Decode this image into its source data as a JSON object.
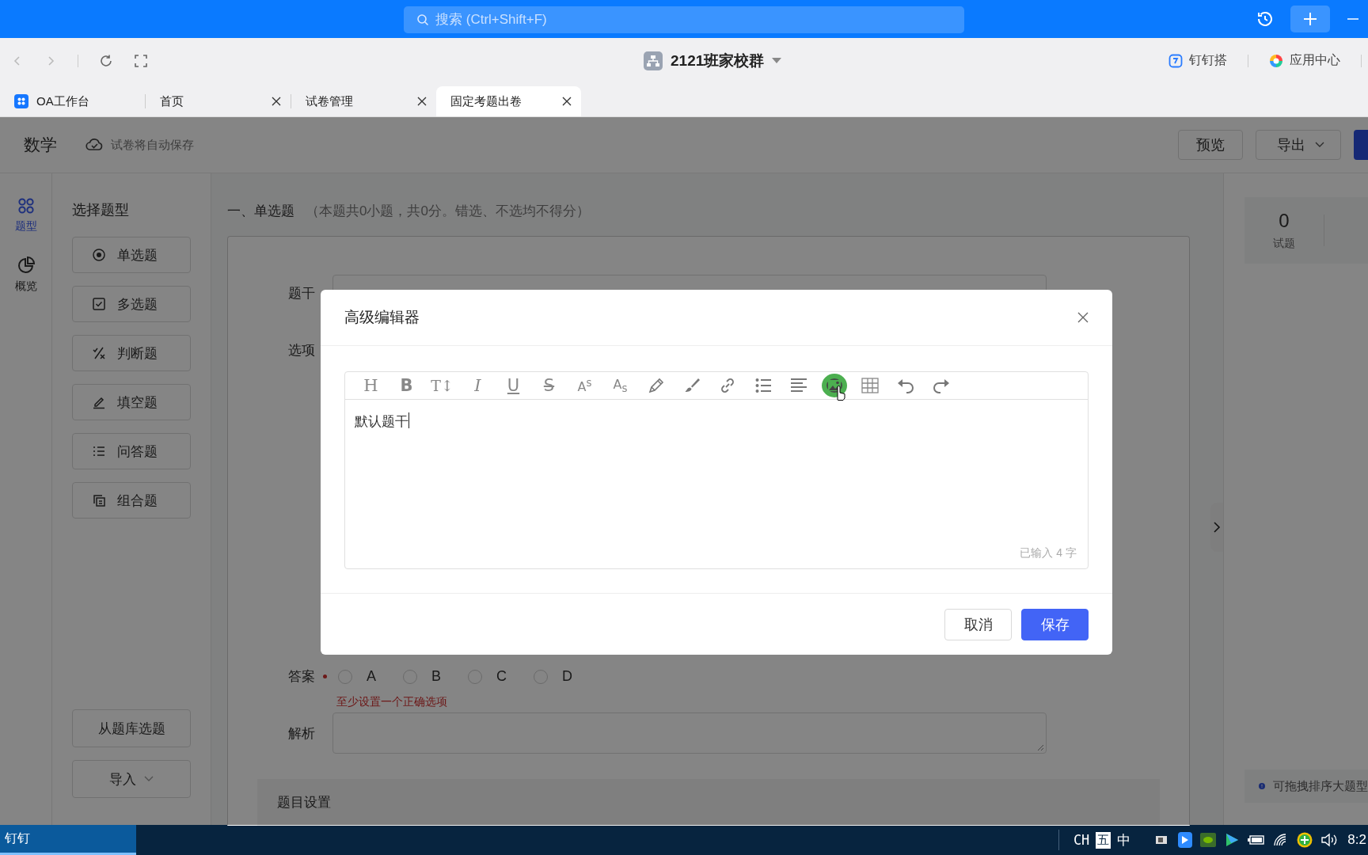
{
  "topbar": {
    "search_placeholder": "搜索 (Ctrl+Shift+F)"
  },
  "navbar": {
    "group_title": "2121班家校群",
    "links": [
      {
        "label": "钉钉搭",
        "kind": "dingda"
      },
      {
        "label": "应用中心",
        "kind": "appcenter"
      }
    ]
  },
  "tabs": [
    {
      "label": "OA工作台",
      "selected": false,
      "closable": false
    },
    {
      "label": "首页",
      "selected": false,
      "closable": true
    },
    {
      "label": "试卷管理",
      "selected": false,
      "closable": true
    },
    {
      "label": "固定考题出卷",
      "selected": true,
      "closable": true
    }
  ],
  "header": {
    "subject": "数学",
    "autosave": "试卷将自动保存",
    "buttons": [
      {
        "label": "预览",
        "kind": "plain"
      },
      {
        "label": "导出",
        "kind": "dropdown"
      },
      {
        "kind": "primary"
      }
    ]
  },
  "rail": [
    {
      "label": "题型",
      "kind": "types",
      "selected": true
    },
    {
      "label": "概览",
      "kind": "overview",
      "selected": false
    }
  ],
  "question_types": {
    "title": "选择题型",
    "items": [
      {
        "label": "单选题",
        "kind": "single"
      },
      {
        "label": "多选题",
        "kind": "multiple"
      },
      {
        "label": "判断题",
        "kind": "judge"
      },
      {
        "label": "填空题",
        "kind": "fill"
      },
      {
        "label": "问答题",
        "kind": "essay"
      },
      {
        "label": "组合题",
        "kind": "group"
      }
    ],
    "bottom_buttons": [
      {
        "label": "从题库选题",
        "kind": "plain"
      },
      {
        "label": "导入",
        "kind": "dropdown"
      }
    ]
  },
  "section": {
    "title": "一、单选题",
    "note": "（本题共0小题，共0分。错选、不选均不得分）"
  },
  "question": {
    "stem_label": "题干",
    "options_label": "选项",
    "answer_label": "答案",
    "required": true,
    "answer_options": [
      {
        "label": "A",
        "selected": false
      },
      {
        "label": "B",
        "selected": false
      },
      {
        "label": "C",
        "selected": false
      },
      {
        "label": "D",
        "selected": false
      }
    ],
    "error": "至少设置一个正确选项",
    "analysis_label": "解析",
    "settings_title": "题目设置"
  },
  "stats": [
    {
      "value": "0",
      "label": "试题"
    }
  ],
  "hint": "可拖拽排序大题型",
  "dialog": {
    "title": "高级编辑器",
    "toolbar": [
      {
        "kind": "heading",
        "glyph": "H",
        "hovered": false
      },
      {
        "kind": "bold",
        "glyph": "B",
        "hovered": false
      },
      {
        "kind": "size",
        "glyph": "T↕",
        "hovered": false
      },
      {
        "kind": "italic",
        "glyph": "I",
        "hovered": false
      },
      {
        "kind": "underline",
        "glyph": "U",
        "hovered": false
      },
      {
        "kind": "strike",
        "glyph": "S",
        "hovered": false
      },
      {
        "kind": "superscript",
        "glyph": "A$^{s}$",
        "hovered": false
      },
      {
        "kind": "subscript",
        "glyph": "A$_{s}$",
        "hovered": false
      },
      {
        "kind": "pen",
        "hovered": false
      },
      {
        "kind": "brush",
        "hovered": false
      },
      {
        "kind": "link",
        "hovered": false
      },
      {
        "kind": "list",
        "hovered": false
      },
      {
        "kind": "align",
        "hovered": false
      },
      {
        "kind": "image",
        "hovered": true
      },
      {
        "kind": "table",
        "hovered": false
      },
      {
        "kind": "undo",
        "hovered": false
      },
      {
        "kind": "redo",
        "hovered": false
      }
    ],
    "content": "默认题干",
    "counter": "已输入 4 字",
    "buttons": [
      {
        "label": "取消",
        "kind": "plain"
      },
      {
        "label": "保存",
        "kind": "primary"
      }
    ]
  },
  "taskbar": {
    "app": "钉钉",
    "tray": [
      {
        "label": "CH",
        "kind": "plain"
      },
      {
        "label": "五",
        "kind": "boxed"
      },
      {
        "label": "中",
        "kind": "plain"
      }
    ],
    "time": "8:2"
  }
}
